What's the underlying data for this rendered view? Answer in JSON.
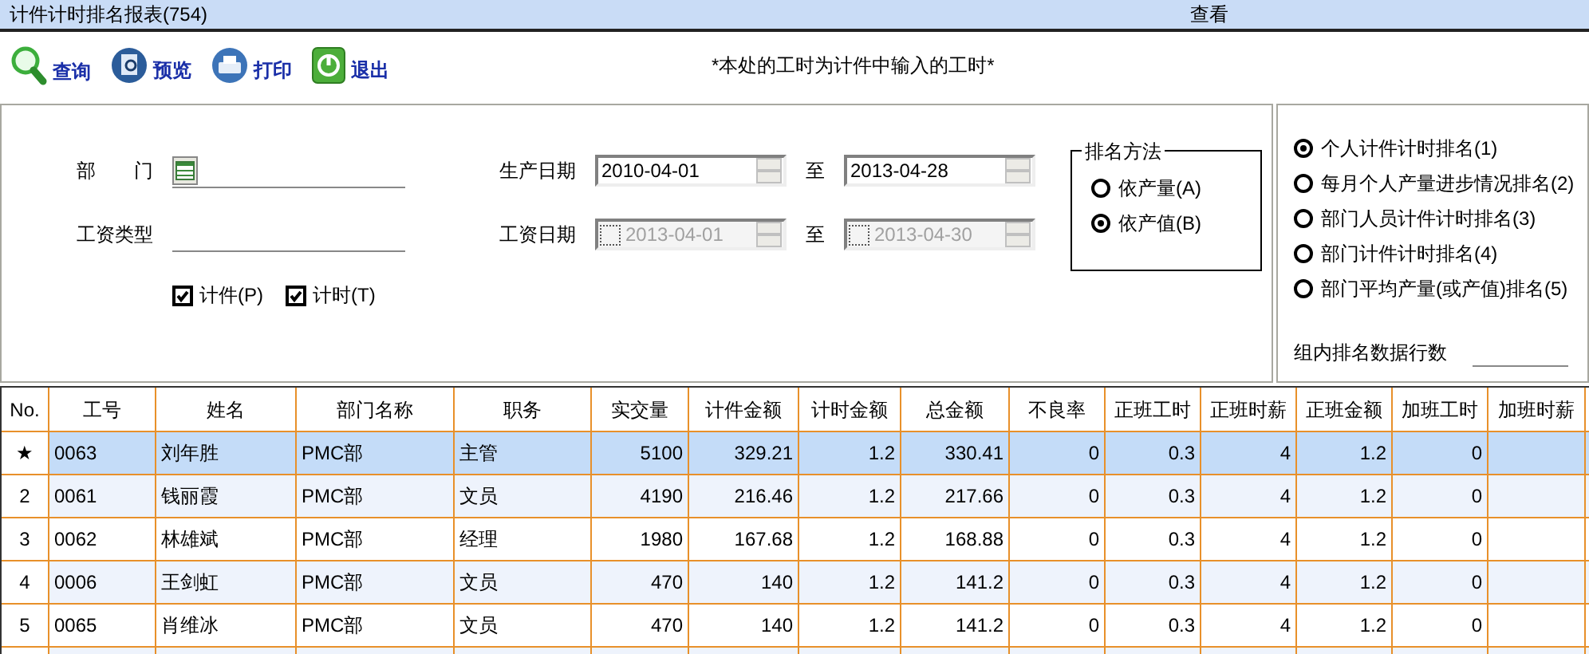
{
  "window": {
    "title": "计件计时排名报表(754)",
    "menu": "查看"
  },
  "toolbar": {
    "buttons": [
      {
        "kind": "search",
        "label": "查询"
      },
      {
        "kind": "preview",
        "label": "预览"
      },
      {
        "kind": "print",
        "label": "打印"
      },
      {
        "kind": "exit",
        "label": "退出"
      }
    ],
    "note": "*本处的工时为计件中输入的工时*"
  },
  "filters": {
    "department": {
      "label": "部　　门"
    },
    "wage_type": {
      "label": "工资类型"
    },
    "options": [
      {
        "label": "计件(P)",
        "checked": true
      },
      {
        "label": "计时(T)",
        "checked": true
      }
    ],
    "production_date": {
      "label": "生产日期",
      "to_label": "至",
      "from": {
        "disabled": false,
        "value": "2010-04-01"
      },
      "to": {
        "disabled": false,
        "value": "2013-04-28"
      }
    },
    "wage_date": {
      "label": "工资日期",
      "to_label": "至",
      "from": {
        "disabled": true,
        "checked": false,
        "value": "2013-04-01"
      },
      "to": {
        "disabled": true,
        "checked": false,
        "value": "2013-04-30"
      }
    },
    "ranking_method": {
      "title": "排名方法",
      "options": [
        {
          "label": "依产量(A)",
          "selected": false
        },
        {
          "label": "依产值(B)",
          "selected": true
        }
      ]
    }
  },
  "ranking_types": {
    "options": [
      {
        "label": "个人计件计时排名(1)",
        "selected": true
      },
      {
        "label": "每月个人产量进步情况排名(2)",
        "selected": false
      },
      {
        "label": "部门人员计件计时排名(3)",
        "selected": false
      },
      {
        "label": "部门计件计时排名(4)",
        "selected": false
      },
      {
        "label": "部门平均产量(或产值)排名(5)",
        "selected": false
      }
    ],
    "rows_per_group": {
      "label": "组内排名数据行数"
    }
  },
  "table": {
    "columns": [
      "No.",
      "工号",
      "姓名",
      "部门名称",
      "职务",
      "实交量",
      "计件金额",
      "计时金额",
      "总金额",
      "不良率",
      "正班工时",
      "正班时薪",
      "正班金额",
      "加班工时",
      "加班时薪"
    ],
    "rows": [
      {
        "selected": true,
        "cells": [
          "★",
          "0063",
          "刘年胜",
          "PMC部",
          "主管",
          "5100",
          "329.21",
          "1.2",
          "330.41",
          "0",
          "0.3",
          "4",
          "1.2",
          "0",
          null
        ]
      },
      {
        "selected": false,
        "cells": [
          "2",
          "0061",
          "钱丽霞",
          "PMC部",
          "文员",
          "4190",
          "216.46",
          "1.2",
          "217.66",
          "0",
          "0.3",
          "4",
          "1.2",
          "0",
          null
        ]
      },
      {
        "selected": false,
        "cells": [
          "3",
          "0062",
          "林雄斌",
          "PMC部",
          "经理",
          "1980",
          "167.68",
          "1.2",
          "168.88",
          "0",
          "0.3",
          "4",
          "1.2",
          "0",
          null
        ]
      },
      {
        "selected": false,
        "cells": [
          "4",
          "0006",
          "王剑虹",
          "PMC部",
          "文员",
          "470",
          "140",
          "1.2",
          "141.2",
          "0",
          "0.3",
          "4",
          "1.2",
          "0",
          null
        ]
      },
      {
        "selected": false,
        "cells": [
          "5",
          "0065",
          "肖维冰",
          "PMC部",
          "文员",
          "470",
          "140",
          "1.2",
          "141.2",
          "0",
          "0.3",
          "4",
          "1.2",
          "0",
          null
        ]
      }
    ]
  }
}
